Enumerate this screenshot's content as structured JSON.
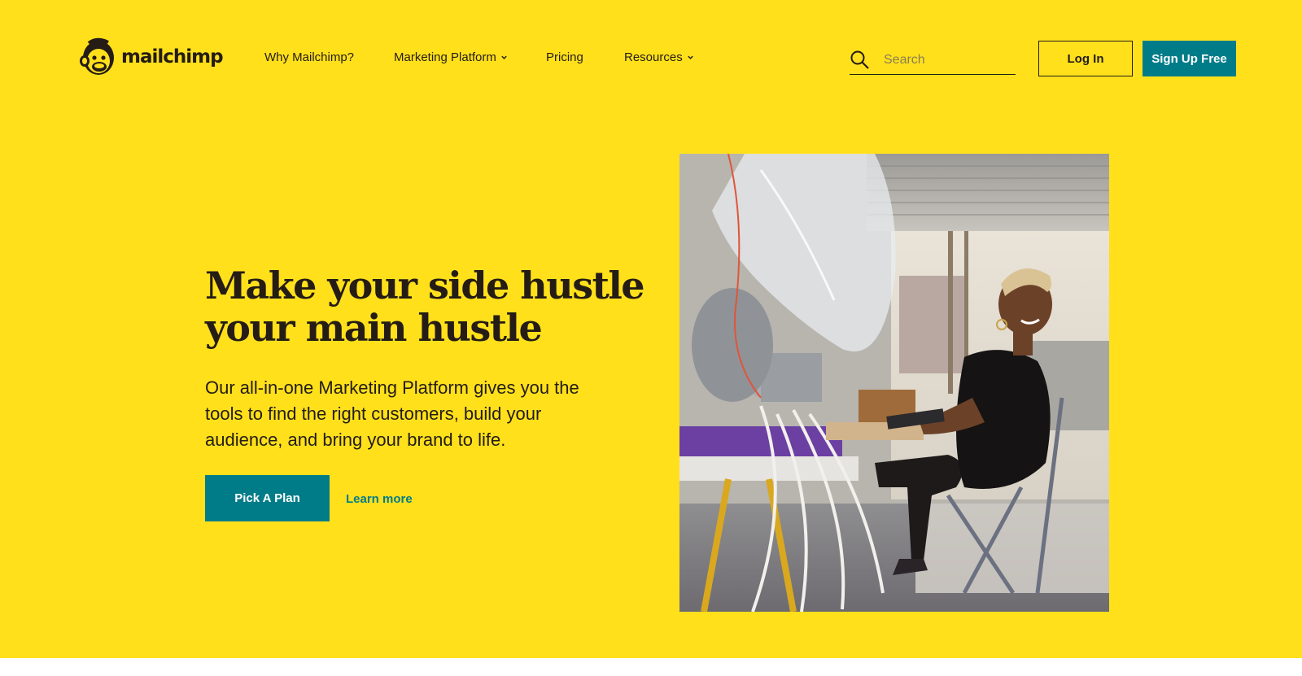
{
  "brand": {
    "name": "mailchimp",
    "logo_icon": "freddie-monkey-icon",
    "background_color": "#FFE01B",
    "accent_color": "#007C89",
    "text_color": "#241c15"
  },
  "nav": {
    "items": [
      {
        "label": "Why Mailchimp?",
        "has_dropdown": false
      },
      {
        "label": "Marketing Platform",
        "has_dropdown": true
      },
      {
        "label": "Pricing",
        "has_dropdown": false
      },
      {
        "label": "Resources",
        "has_dropdown": true
      }
    ],
    "search": {
      "placeholder": "Search",
      "value": "",
      "icon": "search-icon"
    },
    "login_label": "Log In",
    "signup_label": "Sign Up Free"
  },
  "hero": {
    "headline_line1": "Make your side hustle",
    "headline_line2": "your main hustle",
    "subtext": "Our all-in-one Marketing Platform gives you the tools to find the right customers, build your audience, and bring your brand to life.",
    "primary_cta": "Pick A Plan",
    "secondary_cta": "Learn more",
    "image": "photo-woman-working-in-workshop"
  }
}
